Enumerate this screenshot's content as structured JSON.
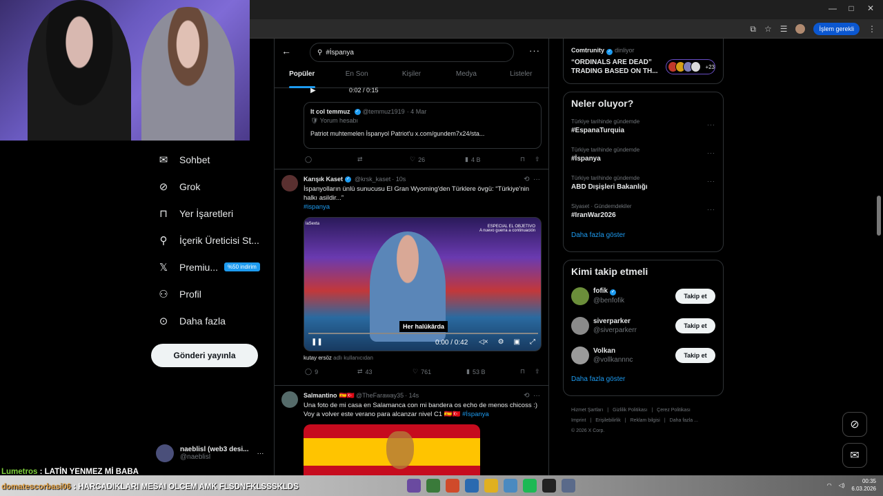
{
  "browser": {
    "window_min": "—",
    "window_max": "□",
    "window_close": "✕",
    "islem_label": "İşlem gerekli"
  },
  "nav": {
    "items": [
      {
        "label": "Sohbet",
        "icon": "envelope-icon",
        "glyph": "✉"
      },
      {
        "label": "Grok",
        "icon": "grok-icon",
        "glyph": "⊘"
      },
      {
        "label": "Yer İşaretleri",
        "icon": "bookmark-icon",
        "glyph": "⊓"
      },
      {
        "label": "İçerik Üreticisi St...",
        "icon": "creator-icon",
        "glyph": "⚲"
      },
      {
        "label": "Premiu...",
        "icon": "x-logo-icon",
        "glyph": "𝕏"
      },
      {
        "label": "Profil",
        "icon": "person-icon",
        "glyph": "⚇"
      },
      {
        "label": "Daha fazla",
        "icon": "more-circle-icon",
        "glyph": "⊙"
      }
    ],
    "premium_badge": "%50 indirim",
    "post_button": "Gönderi yayınla"
  },
  "account": {
    "name": "naeblisl (web3 desi...",
    "handle": "@naeblisl",
    "more": "···"
  },
  "search": {
    "query": "#İspanya",
    "more": "···",
    "back": "←"
  },
  "tabs": [
    "Popüler",
    "En Son",
    "Kişiler",
    "Medya",
    "Listeler"
  ],
  "feed": {
    "partial_media_time": "0:02 / 0:15",
    "quote": {
      "name": "It col temmuz",
      "handle": "@temmuz1919",
      "time": "· 4 Mar",
      "sub": "🛡 Yorum hesabı",
      "text": "Patriot muhtemelen İspanyol Patriot'u x.com/gundem7x24/sta..."
    },
    "actions1": {
      "reply": "",
      "retweet": "",
      "like": "26",
      "views": "4 B"
    },
    "tweet2": {
      "name": "Karışık Kaset",
      "handle": "@krsk_kaset",
      "time": "· 10s",
      "text": "İspanyolların ünlü sunucusu El Gran Wyoming'den Türklere övgü: “Türkiye'nin halkı asildir...”",
      "hashtag": "#ispanya",
      "video_subtitle": "Her halükârda",
      "video_time": "0:00 / 0:42",
      "video_brand": "laSexta",
      "video_show": "ESPECIAL EL OBJETIVO",
      "video_show_sub": "A nuevo guerra a continuación",
      "via_user": "kutay ersöz",
      "via_text": "adlı kullanıcıdan",
      "reply": "9",
      "retweet": "43",
      "like": "761",
      "views": "53 B"
    },
    "tweet3": {
      "name": "Salmantino",
      "flags": "🇪🇸🇹🇷",
      "handle": "@TheFaraway35",
      "time": "· 14s",
      "text": "Una foto de mi casa en Salamanca con mi bandera os echo de menos chicoss :) Voy a volver este verano para alcanzar nivel C1 🇪🇸🇹🇷",
      "hashtag": "#İspanya"
    }
  },
  "right": {
    "top_card": {
      "source": "Comtrunity",
      "status": "dinliyor",
      "headline": "“ORDINALS ARE DEAD” TRADING BASED ON TH...",
      "plus": "+23"
    },
    "trends_title": "Neler oluyor?",
    "trends": [
      {
        "context": "Türkiye tarihinde gündemde",
        "name": "#EspanaTurquia"
      },
      {
        "context": "Türkiye tarihinde gündemde",
        "name": "#İspanya"
      },
      {
        "context": "Türkiye tarihinde gündemde",
        "name": "ABD Dışişleri Bakanlığı"
      },
      {
        "context": "Siyaset · Gündemdekiler",
        "name": "#IranWar2026"
      }
    ],
    "trends_more": "Daha fazla göster",
    "who_title": "Kimi takip etmeli",
    "who": [
      {
        "name": "fofik",
        "handle": "@benfofik",
        "verified": true
      },
      {
        "name": "siverparker",
        "handle": "@siverparkerr",
        "verified": false
      },
      {
        "name": "Volkan",
        "handle": "@vollkannnc",
        "verified": false
      }
    ],
    "follow_label": "Takip et",
    "who_more": "Daha fazla göster",
    "footer": [
      "Hizmet Şartları",
      "|",
      "Gizlilik Politikası",
      "|",
      "Çerez Politikası",
      "|",
      "Imprint",
      "|",
      "Erişilebilirlik",
      "|",
      "Reklam bilgisi",
      "|",
      "Daha fazla ...",
      "© 2026 X Corp."
    ]
  },
  "chat": {
    "line1_user": "Lumetros",
    "line1_text": ": LATİN YENMEZ Mİ BABA",
    "line2_user": "domatescorbasi06",
    "line2_text": ": HARCADIKLARI MESAI OLCEM AMK FLSDNFKLSSSKLDS"
  },
  "clock": {
    "time": "00:35",
    "date": "6.03.2026"
  }
}
